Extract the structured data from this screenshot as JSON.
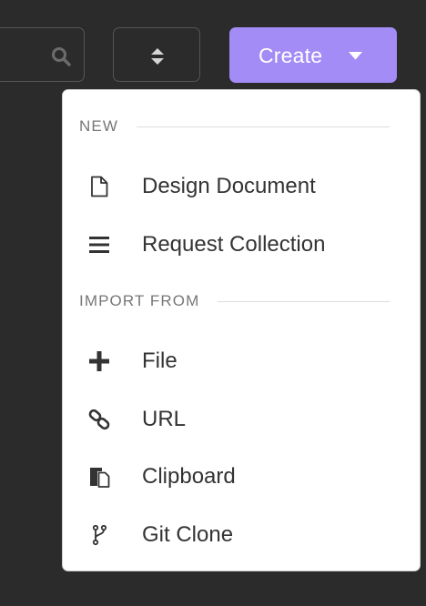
{
  "toolbar": {
    "search_icon": "search-icon",
    "sort_icon": "sort-icon",
    "create_label": "Create",
    "create_caret_icon": "caret-down-icon",
    "accent_color": "#a38cf6"
  },
  "dropdown": {
    "new_section": {
      "label": "NEW",
      "items": [
        {
          "label": "Design Document",
          "icon": "document-icon"
        },
        {
          "label": "Request Collection",
          "icon": "list-icon"
        }
      ]
    },
    "import_section": {
      "label": "IMPORT FROM",
      "items": [
        {
          "label": "File",
          "icon": "plus-icon"
        },
        {
          "label": "URL",
          "icon": "link-icon"
        },
        {
          "label": "Clipboard",
          "icon": "clipboard-icon"
        },
        {
          "label": "Git Clone",
          "icon": "git-branch-icon"
        }
      ]
    }
  }
}
